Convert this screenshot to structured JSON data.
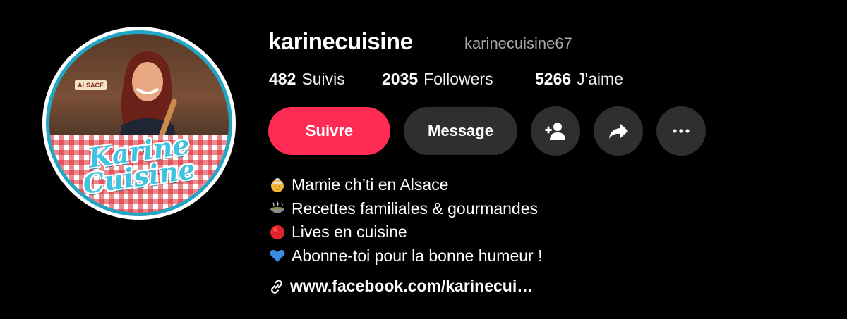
{
  "profile": {
    "username": "karinecuisine",
    "handle": "karinecuisine67",
    "avatar_logo_line1": "Karine",
    "avatar_logo_line2": "Cuisine",
    "avatar_sign": "ALSACE"
  },
  "stats": [
    {
      "value": "482",
      "label": "Suivis"
    },
    {
      "value": "2035",
      "label": "Followers"
    },
    {
      "value": "5266",
      "label": "J'aime"
    }
  ],
  "buttons": {
    "follow": "Suivre",
    "message": "Message",
    "add_friend_icon": "add-user-icon",
    "share_icon": "share-icon",
    "more_icon": "more-icon"
  },
  "bio": [
    {
      "icon": "grandma-emoji",
      "text": "Mamie ch’ti en Alsace"
    },
    {
      "icon": "stew-bowl-emoji",
      "text": "Recettes familiales & gourmandes"
    },
    {
      "icon": "red-circle-emoji",
      "text": "Lives en cuisine"
    },
    {
      "icon": "blue-heart-emoji",
      "text": "Abonne-toi pour la bonne humeur !"
    }
  ],
  "link": {
    "icon": "link-icon",
    "text": "www.facebook.com/karinecui…"
  },
  "colors": {
    "background": "#000000",
    "follow_button": "#fe2c55",
    "secondary_button": "#2f2f2f",
    "handle_text": "#a8a8a8",
    "avatar_ring": "#23a6c4"
  }
}
